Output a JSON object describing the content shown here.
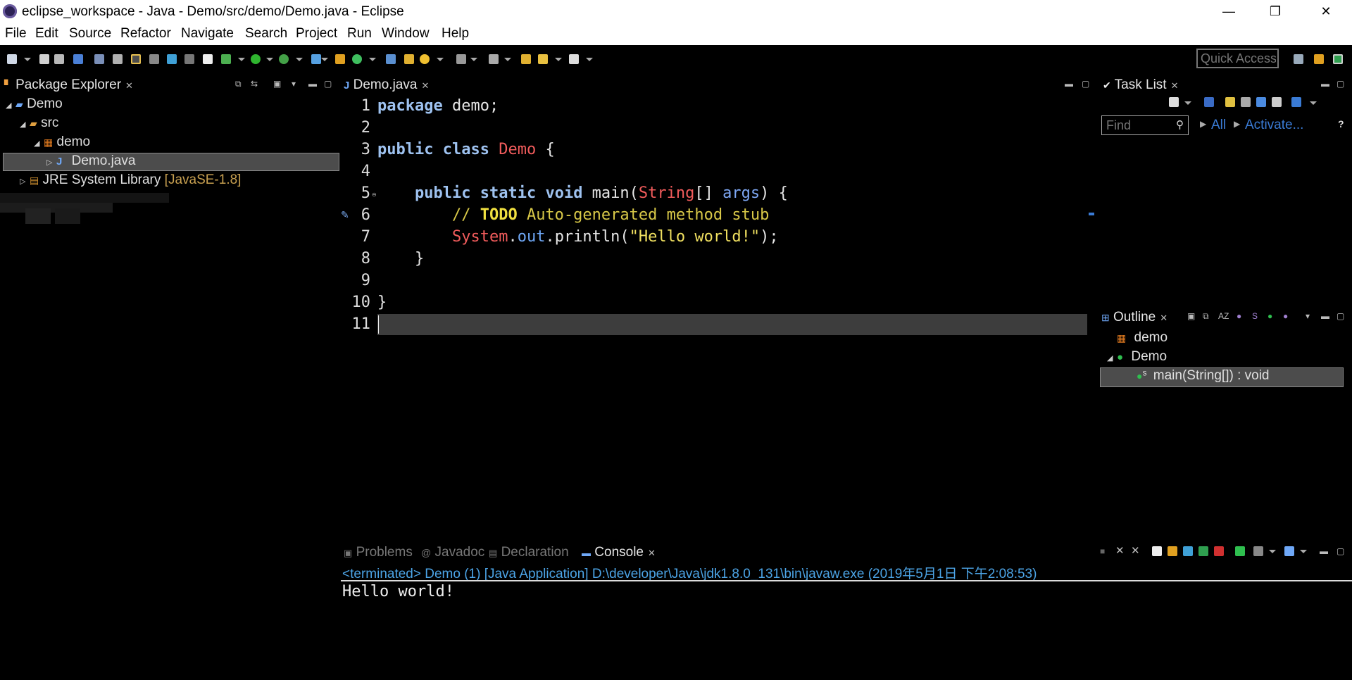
{
  "window": {
    "title": "eclipse_workspace - Java - Demo/src/demo/Demo.java - Eclipse",
    "minimize": "—",
    "restore": "❐",
    "close": "✕"
  },
  "menu": [
    "File",
    "Edit",
    "Source",
    "Refactor",
    "Navigate",
    "Search",
    "Project",
    "Run",
    "Window",
    "Help"
  ],
  "toolbar": {
    "quick_access_placeholder": "Quick Access"
  },
  "package_explorer": {
    "tab_label": "Package Explorer",
    "tree": [
      {
        "label": "Demo",
        "icon": "java-project-icon"
      },
      {
        "label": "src",
        "icon": "source-folder-icon"
      },
      {
        "label": "demo",
        "icon": "package-icon"
      },
      {
        "label": "Demo.java",
        "icon": "java-file-icon",
        "selected": true
      },
      {
        "label": "JRE System Library",
        "suffix": "[JavaSE-1.8]",
        "icon": "library-icon"
      }
    ]
  },
  "editor": {
    "tab_label": "Demo.java",
    "line_numbers": [
      "1",
      "2",
      "3",
      "4",
      "5",
      "6",
      "7",
      "8",
      "9",
      "10",
      "11"
    ],
    "code": {
      "l1_kw": "package",
      "l1_rest": " demo;",
      "l3_kw1": "public",
      "l3_kw2": "class",
      "l3_cls": "Demo",
      "l3_rest": " {",
      "l5_kw1": "public",
      "l5_kw2": "static",
      "l5_kw3": "void",
      "l5_name": " main(",
      "l5_type": "String",
      "l5_mid": "[] ",
      "l5_param": "args",
      "l5_end": ") {",
      "l6_cmt1": "// ",
      "l6_todo": "TODO",
      "l6_cmt2": " Auto-generated method stub",
      "l7_cls": "System",
      "l7_dot1": ".",
      "l7_field": "out",
      "l7_call": ".println(",
      "l7_str": "\"Hello world!\"",
      "l7_end": ");",
      "l8": "}",
      "l10": "}"
    }
  },
  "task_list": {
    "tab_label": "Task List",
    "find_placeholder": "Find",
    "all_link": "All",
    "activate_link": "Activate...",
    "help": "?"
  },
  "outline": {
    "tab_label": "Outline",
    "items": [
      {
        "label": "demo",
        "icon": "package-icon"
      },
      {
        "label": "Demo",
        "icon": "class-icon"
      },
      {
        "label": "main(String[]) : void",
        "icon": "public-static-method-icon",
        "selected": true
      }
    ]
  },
  "bottom_tabs": {
    "problems": "Problems",
    "javadoc": "Javadoc",
    "declaration": "Declaration",
    "console": "Console"
  },
  "console": {
    "description": "<terminated> Demo (1) [Java Application] D:\\developer\\Java\\jdk1.8.0_131\\bin\\javaw.exe (2019年5月1日 下午2:08:53)",
    "output": "Hello world!"
  },
  "colors": {
    "background": "#000000",
    "keyword": "#9ec2f0",
    "class_name": "#f25c5c",
    "comment": "#d8c848",
    "string": "#f0e060",
    "link": "#3a7bd5",
    "selection": "#4c4c4c"
  }
}
